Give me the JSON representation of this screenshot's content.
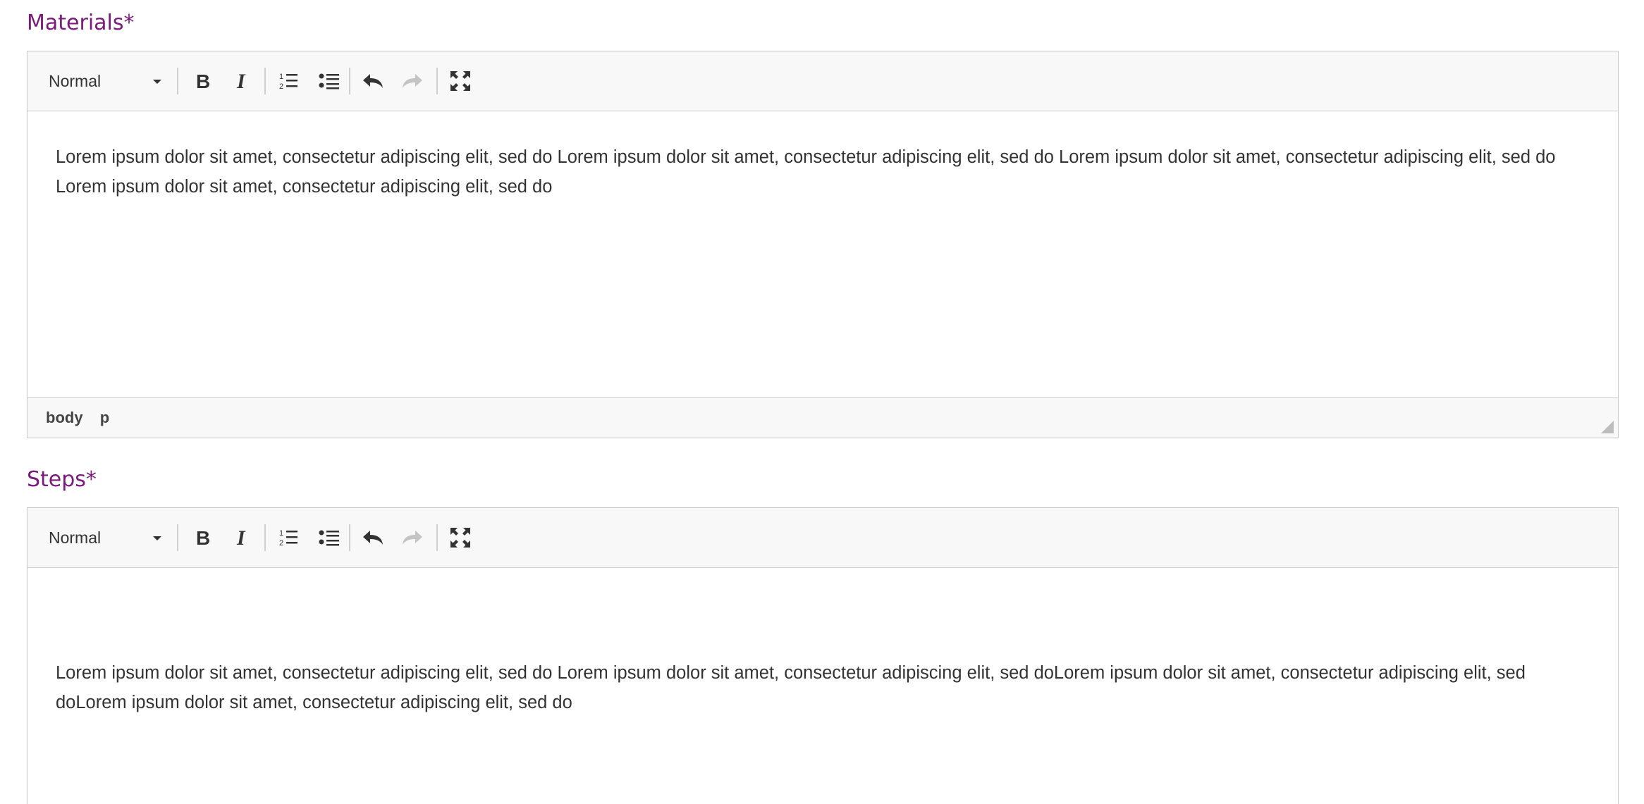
{
  "materials": {
    "label": "Materials*",
    "toolbar": {
      "format_value": "Normal"
    },
    "content": "Lorem ipsum dolor sit amet, consectetur adipiscing elit, sed do Lorem ipsum dolor sit amet, consectetur adipiscing elit, sed do Lorem ipsum dolor sit amet, consectetur adipiscing elit, sed do Lorem ipsum dolor sit amet, consectetur adipiscing elit, sed do",
    "statusbar": {
      "path": [
        "body",
        "p"
      ]
    }
  },
  "steps": {
    "label": "Steps*",
    "toolbar": {
      "format_value": "Normal"
    },
    "content": "Lorem ipsum dolor sit amet, consectetur adipiscing elit, sed do Lorem ipsum dolor sit amet, consectetur adipiscing elit, sed doLorem ipsum dolor sit amet, consectetur adipiscing elit, sed  doLorem ipsum dolor sit amet, consectetur adipiscing elit, sed do"
  },
  "icons": {
    "bold": "bold-icon",
    "italic": "italic-icon",
    "numbered_list": "numbered-list-icon",
    "bullet_list": "bullet-list-icon",
    "undo": "undo-icon",
    "redo": "redo-icon",
    "fullscreen": "fullscreen-icon"
  },
  "colors": {
    "label": "#7b1a7b",
    "toolbar_bg": "#f8f8f8",
    "border": "#c8c8c8",
    "text": "#333333",
    "disabled_icon": "#c4c4c4"
  }
}
